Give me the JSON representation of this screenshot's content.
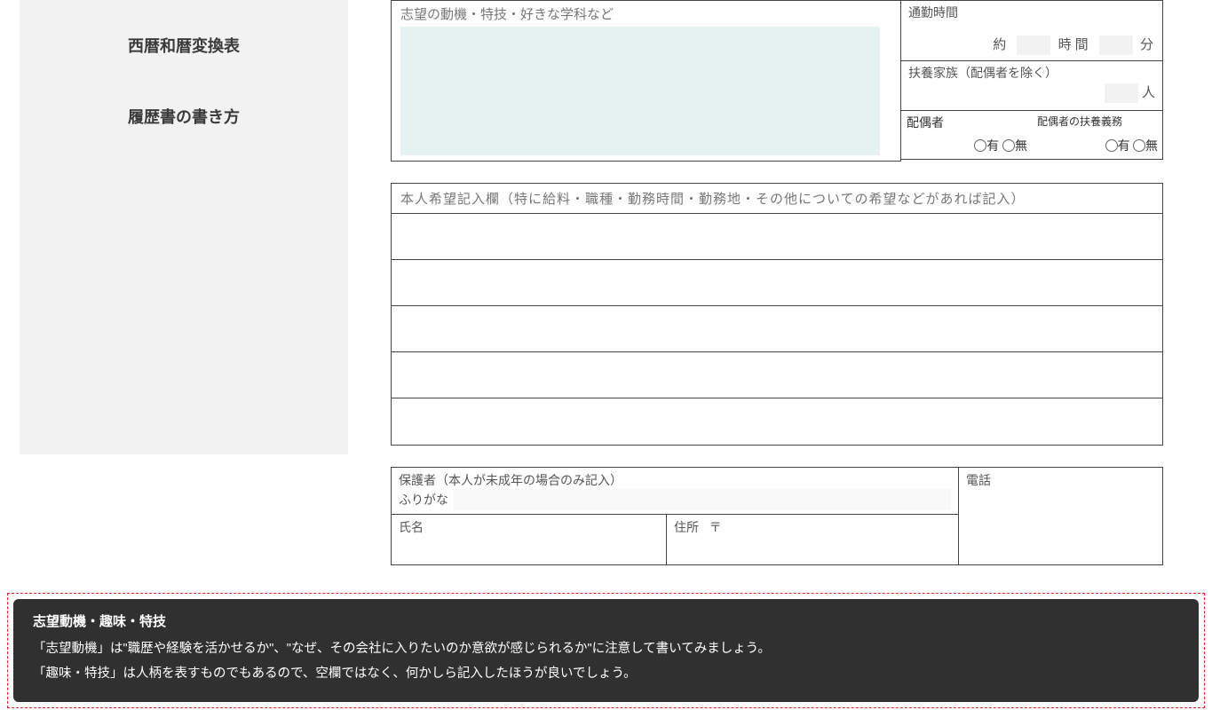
{
  "sidebar": {
    "link1": "西暦和暦変換表",
    "link2": "履歴書の書き方"
  },
  "motive": {
    "label": "志望の動機・特技・好きな学科など"
  },
  "commute": {
    "label": "通勤時間",
    "approx": "約",
    "hours": "時間",
    "minutes": "分"
  },
  "dependents": {
    "label": "扶養家族（配偶者を除く）",
    "unit": "人"
  },
  "spouse": {
    "label": "配偶者",
    "yes": "有",
    "no": "無"
  },
  "spouse_support": {
    "label": "配偶者の扶養義務",
    "yes": "有",
    "no": "無"
  },
  "wishes": {
    "label": "本人希望記入欄（特に給料・職種・勤務時間・勤務地・その他についての希望などがあれば記入）"
  },
  "guardian": {
    "label": "保護者（本人が未成年の場合のみ記入）",
    "furigana": "ふりがな",
    "name": "氏名",
    "address": "住所",
    "postmark": "〒",
    "tel": "電話"
  },
  "tip": {
    "title": "志望動機・趣味・特技",
    "line1": "「志望動機」は\"職歴や経験を活かせるか\"、\"なぜ、その会社に入りたいのか意欲が感じられるか\"に注意して書いてみましょう。",
    "line2": "「趣味・特技」は人柄を表すものでもあるので、空欄ではなく、何かしら記入したほうが良いでしょう。"
  }
}
